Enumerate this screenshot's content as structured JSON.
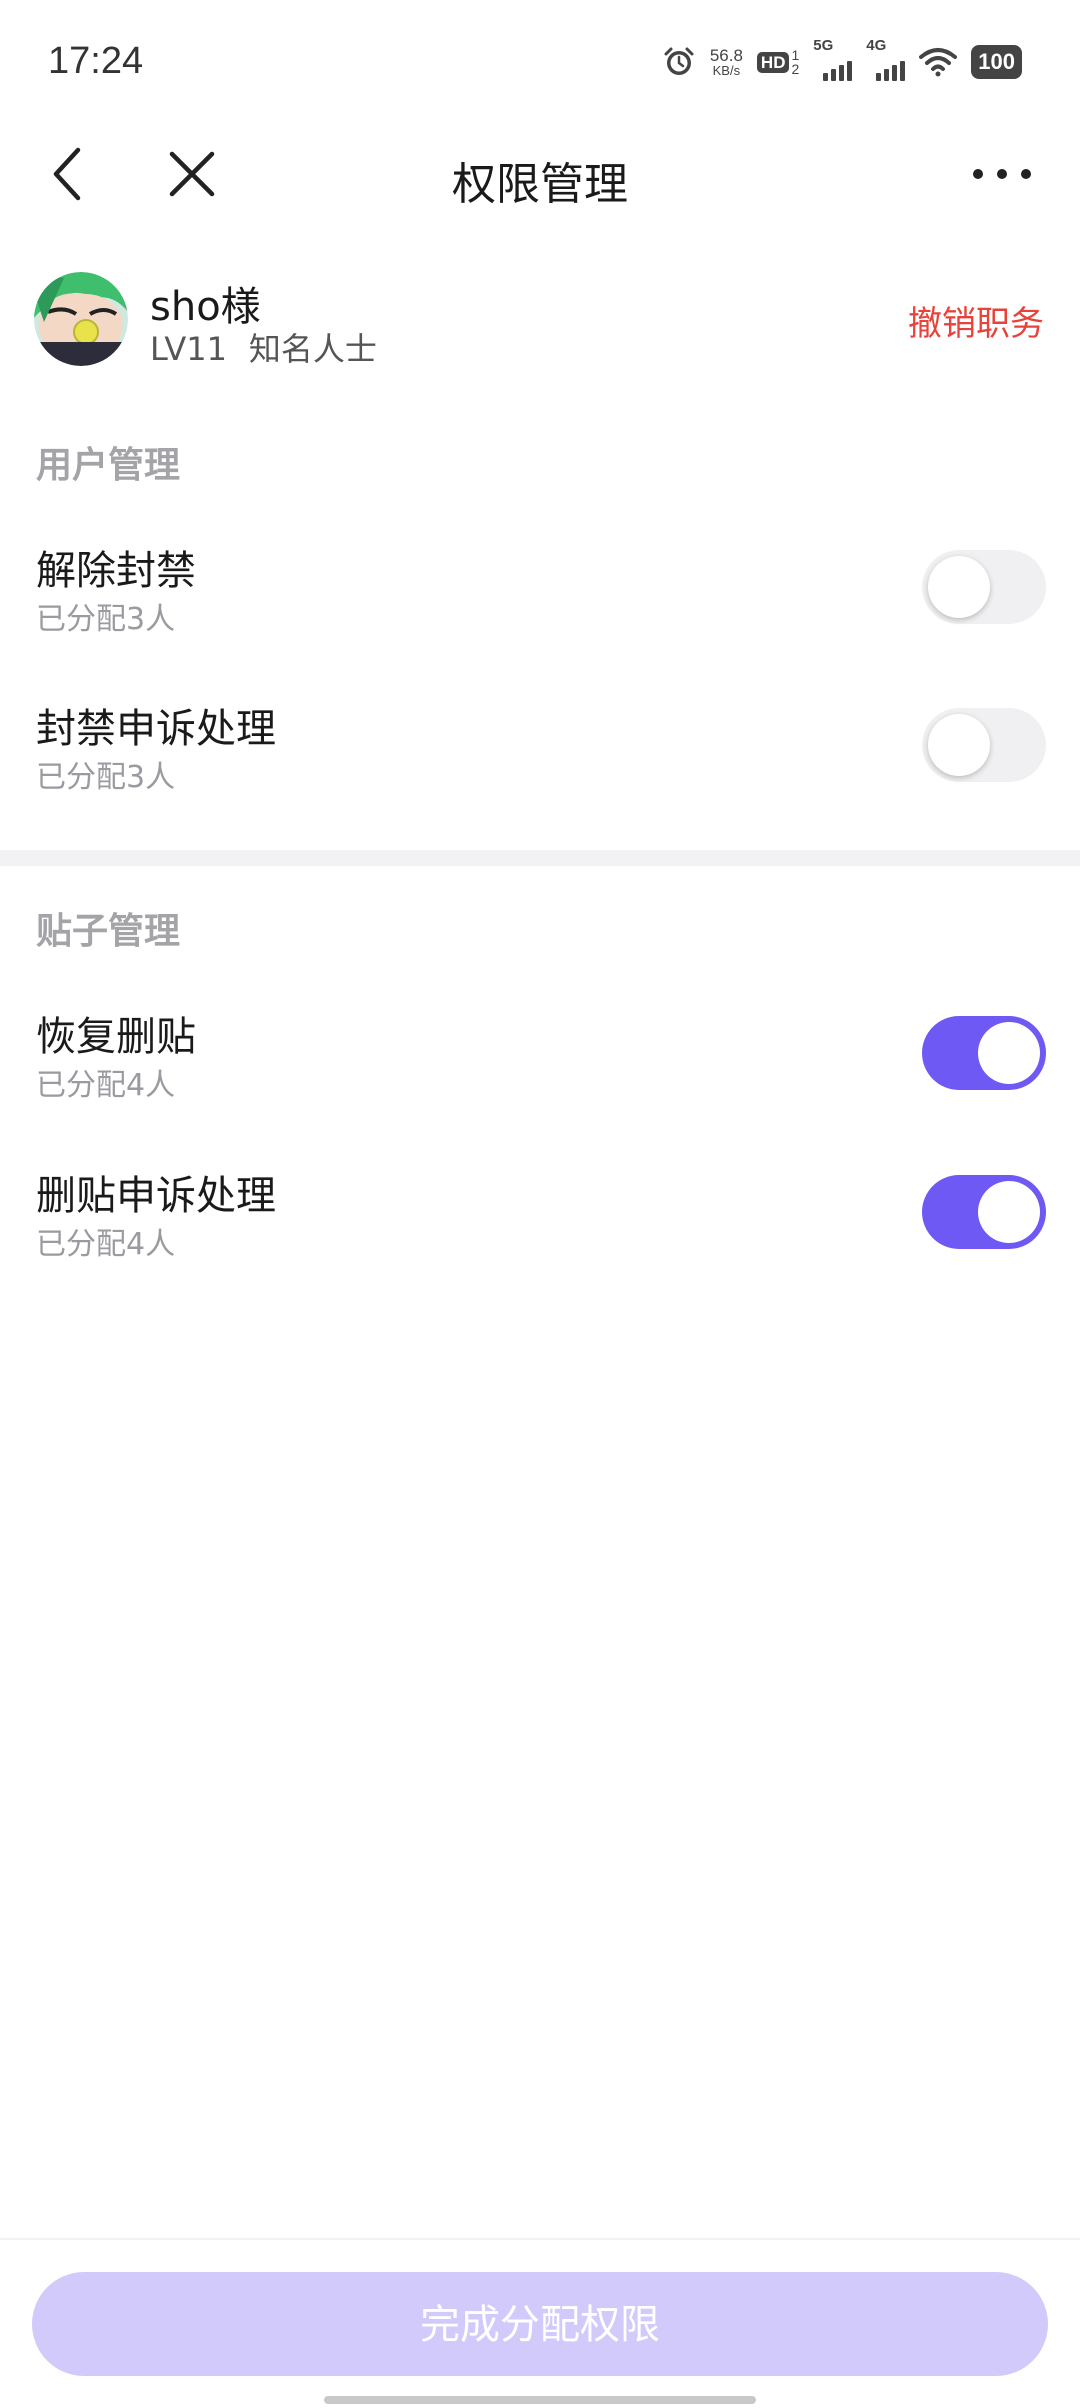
{
  "status_bar": {
    "time": "17:24",
    "net_speed_value": "56.8",
    "net_speed_unit": "KB/s",
    "hd_label": "HD",
    "hd_sim_top": "1",
    "hd_sim_bottom": "2",
    "net1_label": "5G",
    "net2_label": "4G",
    "battery": "100"
  },
  "nav": {
    "title": "权限管理"
  },
  "user": {
    "name": "sho様",
    "level": "LV11",
    "title_tag": "知名人士",
    "revoke_label": "撤销职务"
  },
  "sections": [
    {
      "title": "用户管理",
      "items": [
        {
          "label": "解除封禁",
          "sub": "已分配3人",
          "enabled": false
        },
        {
          "label": "封禁申诉处理",
          "sub": "已分配3人",
          "enabled": false
        }
      ]
    },
    {
      "title": "贴子管理",
      "items": [
        {
          "label": "恢复删贴",
          "sub": "已分配4人",
          "enabled": true
        },
        {
          "label": "删贴申诉处理",
          "sub": "已分配4人",
          "enabled": true
        }
      ]
    }
  ],
  "footer": {
    "confirm_label": "完成分配权限"
  },
  "colors": {
    "accent": "#6e59f5",
    "accent_disabled": "#d2cafb",
    "danger": "#e8433a"
  }
}
